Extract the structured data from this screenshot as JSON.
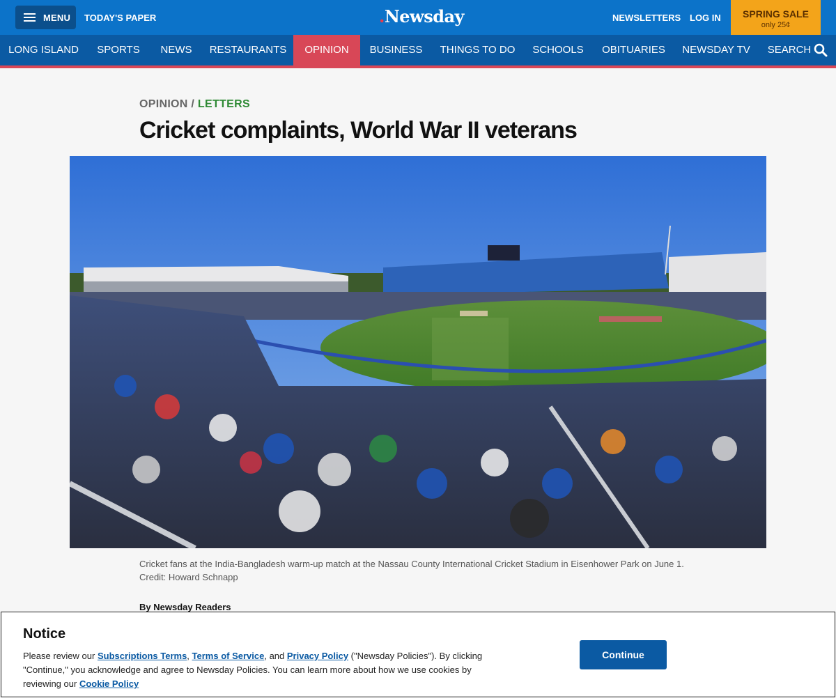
{
  "header": {
    "menu_label": "MENU",
    "todays_paper": "TODAY'S PAPER",
    "logo_text": "Newsday",
    "newsletters": "NEWSLETTERS",
    "login": "LOG IN",
    "sale_title": "SPRING SALE",
    "sale_sub": "only 25¢"
  },
  "nav": {
    "items": [
      {
        "label": "LONG ISLAND"
      },
      {
        "label": "SPORTS"
      },
      {
        "label": "NEWS"
      },
      {
        "label": "RESTAURANTS"
      },
      {
        "label": "OPINION",
        "active": true
      },
      {
        "label": "BUSINESS"
      },
      {
        "label": "THINGS TO DO"
      },
      {
        "label": "SCHOOLS"
      },
      {
        "label": "OBITUARIES"
      },
      {
        "label": "NEWSDAY TV"
      },
      {
        "label": "SEARCH"
      }
    ],
    "active_color": "#d84757"
  },
  "article": {
    "section": "OPINION",
    "separator": "/",
    "subsection": "LETTERS",
    "headline": "Cricket complaints, World War II veterans",
    "caption": "Cricket fans at the India-Bangladesh warm-up match at the Nassau County International Cricket Stadium in Eisenhower Park on June 1. Credit: Howard Schnapp",
    "byline": "By Newsday Readers"
  },
  "notice": {
    "title": "Notice",
    "text_1": "Please review our ",
    "link_subscriptions": "Subscriptions Terms",
    "text_2": ", ",
    "link_tos": "Terms of Service",
    "text_3": ", and ",
    "link_privacy": "Privacy Policy",
    "text_4": " (\"Newsday Policies\"). By clicking \"Continue,\" you acknowledge and agree to Newsday Policies. You can learn more about how we use cookies by reviewing our ",
    "link_cookie": "Cookie Policy",
    "continue_label": "Continue"
  },
  "colors": {
    "top_blue": "#0c73c9",
    "nav_blue": "#0b5aa3",
    "sale_orange": "#f3a41a",
    "letters_green": "#2f8a35"
  }
}
